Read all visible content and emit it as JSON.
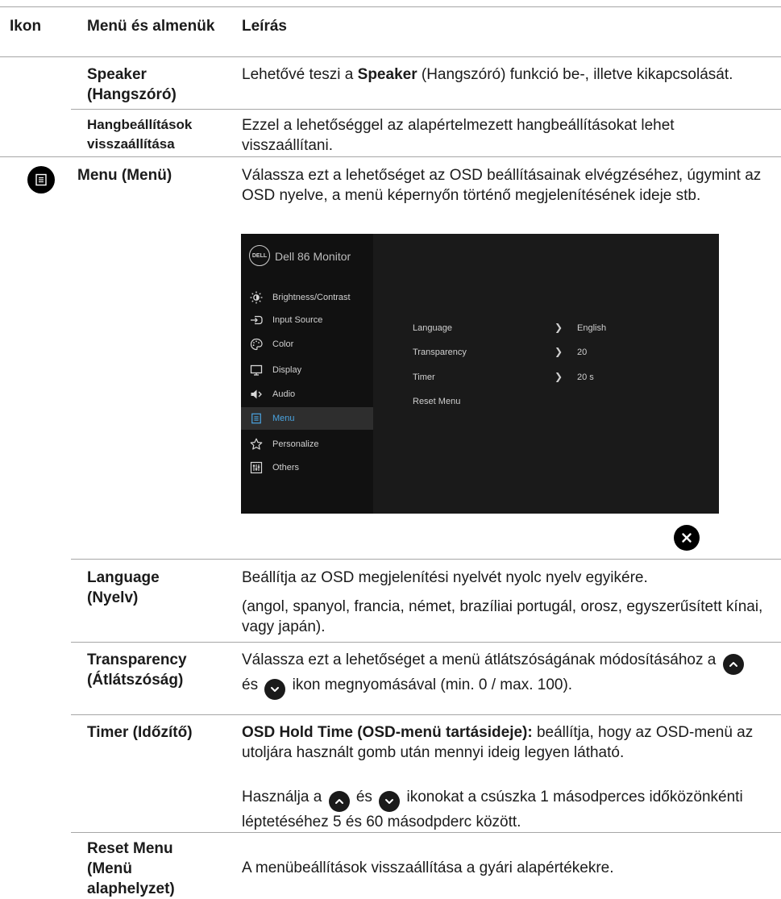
{
  "header": {
    "col_icon": "Ikon",
    "col_menu": "Menü és almenük",
    "col_desc": "Leírás"
  },
  "rows": {
    "speaker": {
      "name": "Speaker (Hangszóró)",
      "desc_pre": "Lehetővé teszi a ",
      "desc_bold": "Speaker",
      "desc_post": " (Hangszóró) funkció be-, illetve kikapcsolását."
    },
    "audio_reset": {
      "name": "Hangbeállítások visszaállítása",
      "desc": "Ezzel a lehetőséggel az alapértelmezett hangbeállításokat lehet visszaállítani."
    },
    "menu": {
      "icon": "menu-icon",
      "name": "Menu (Menü)",
      "desc": "Válassza ezt a lehetőséget az OSD beállításainak elvégzéséhez, úgymint az OSD nyelve, a menü képernyőn történő megjelenítésének ideje stb."
    },
    "language": {
      "name": "Language (Nyelv)",
      "desc1": "Beállítja az OSD megjelenítési nyelvét nyolc nyelv egyikére.",
      "desc2": "(angol, spanyol, francia, német, brazíliai portugál, orosz, egyszerűsített kínai, vagy japán)."
    },
    "transparency": {
      "name": "Transparency (Átlátszóság)",
      "desc_pre": "Válassza ezt a lehetőséget a menü átlátszóságának módosításához a",
      "desc_mid": "és",
      "desc_post": "ikon megnyomásával (min. 0 / max. 100)."
    },
    "timer": {
      "name": "Timer (Időzítő)",
      "desc_bold": "OSD Hold Time (OSD-menü tartásideje):",
      "desc_rest": " beállítja, hogy az OSD-menü az utoljára használt gomb után mennyi ideig legyen látható.",
      "desc2_pre": "Használja a",
      "desc2_mid": "és",
      "desc2_post": "ikonokat a csúszka 1 másodperces időközönkénti léptetéséhez 5 és 60 másodpderc között."
    },
    "reset_menu": {
      "name": "Reset Menu (Menü alaphelyzet)",
      "desc": "A menübeállítások visszaállítása a gyári alapértékekre."
    }
  },
  "osd": {
    "logo": "DELL",
    "title": "Dell 86 Monitor",
    "menu_items": [
      {
        "label": "Brightness/Contrast",
        "icon": "brightness-icon"
      },
      {
        "label": "Input Source",
        "icon": "input-source-icon"
      },
      {
        "label": "Color",
        "icon": "color-palette-icon"
      },
      {
        "label": "Display",
        "icon": "display-icon"
      },
      {
        "label": "Audio",
        "icon": "speaker-icon"
      },
      {
        "label": "Menu",
        "icon": "menu-icon",
        "active": true
      },
      {
        "label": "Personalize",
        "icon": "star-icon"
      },
      {
        "label": "Others",
        "icon": "others-icon"
      }
    ],
    "settings": [
      {
        "label": "Language",
        "value": "English"
      },
      {
        "label": "Transparency",
        "value": "20"
      },
      {
        "label": "Timer",
        "value": "20 s"
      },
      {
        "label": "Reset Menu",
        "value": ""
      }
    ],
    "close_icon": "close-icon"
  },
  "colors": {
    "osd_background": "#1a1a1a",
    "osd_sidebar": "#111111",
    "osd_active_item": "#2e2e2e",
    "accent": "#4aa3df",
    "rule": "#a6a6a6"
  }
}
